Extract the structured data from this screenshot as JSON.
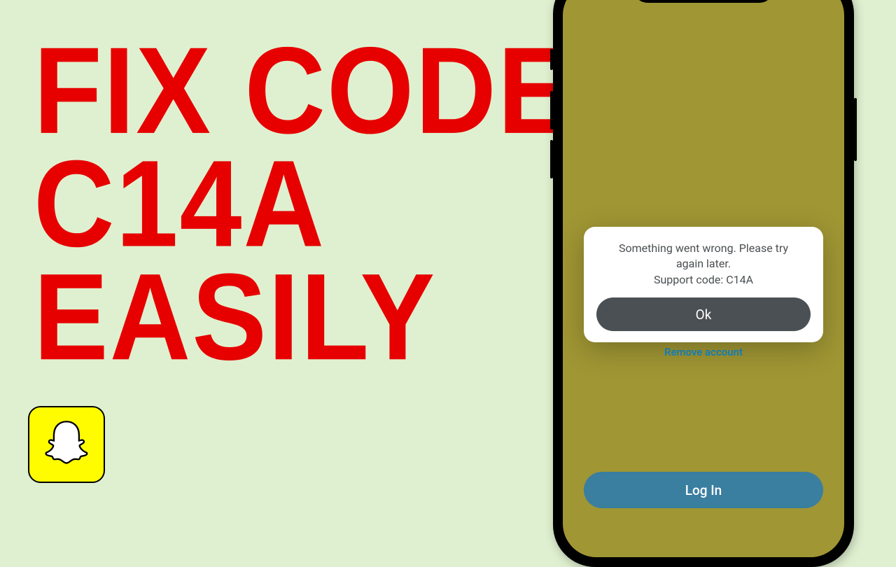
{
  "headline": {
    "line1": "Fix Code",
    "line2": "C14A",
    "line3": "Easily"
  },
  "app_icon": {
    "name": "snapchat-ghost-icon"
  },
  "phone": {
    "remove_account_label": "Remove account",
    "login_label": "Log In",
    "alert": {
      "message_line1": "Something went wrong. Please try",
      "message_line2": "again later.",
      "support_code": "Support code: C14A",
      "ok_label": "Ok"
    }
  },
  "colors": {
    "background": "#dff0d0",
    "headline_red": "#e60000",
    "phone_screen": "#a09634",
    "login_blue": "#3a7ea0",
    "link_blue": "#0a8bd6",
    "alert_button": "#4b5054",
    "snap_yellow": "#fffc00"
  }
}
